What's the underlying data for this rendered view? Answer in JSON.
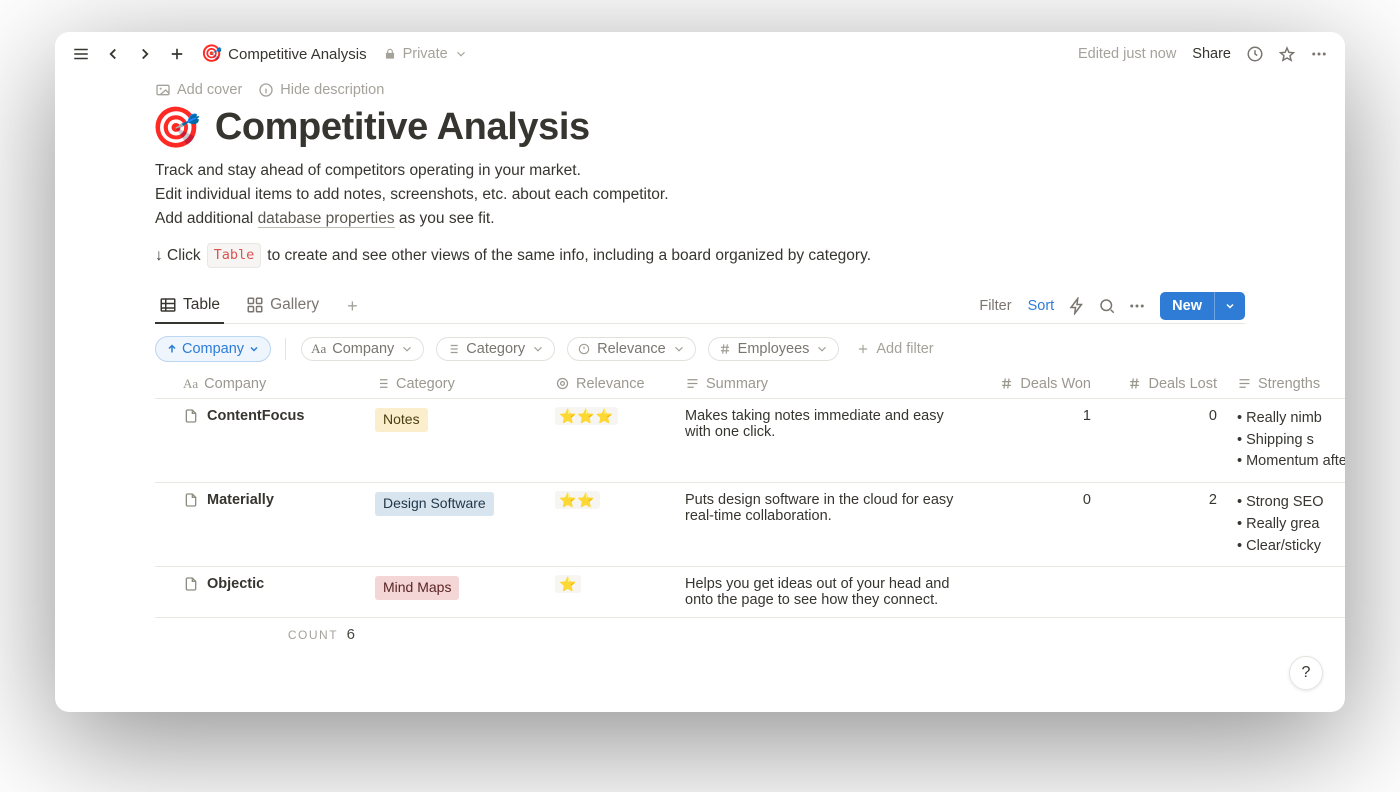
{
  "breadcrumb": {
    "emoji": "🎯",
    "title": "Competitive Analysis",
    "privacy": "Private"
  },
  "topbar": {
    "edited": "Edited just now",
    "share": "Share"
  },
  "cover": {
    "add_cover": "Add cover",
    "hide_desc": "Hide description"
  },
  "page": {
    "emoji": "🎯",
    "title": "Competitive Analysis",
    "desc_line1": "Track and stay ahead of competitors operating in your market.",
    "desc_line2": "Edit individual items to add notes, screenshots, etc. about each competitor.",
    "desc_line3_pre": "Add additional ",
    "desc_line3_link": "database properties",
    "desc_line3_post": " as you see fit.",
    "click_pre": "↓ Click ",
    "click_code": "Table",
    "click_post": " to create and see other views of the same info, including a board organized by category."
  },
  "views": {
    "tab_table": "Table",
    "tab_gallery": "Gallery",
    "filter": "Filter",
    "sort": "Sort",
    "new": "New"
  },
  "filters": {
    "sort_pill": "Company",
    "chip_company": "Company",
    "chip_category": "Category",
    "chip_relevance": "Relevance",
    "chip_employees": "Employees",
    "add_filter": "Add filter"
  },
  "columns": {
    "company": "Company",
    "category": "Category",
    "relevance": "Relevance",
    "summary": "Summary",
    "deals_won": "Deals Won",
    "deals_lost": "Deals Lost",
    "strengths": "Strengths"
  },
  "rows": [
    {
      "company": "ContentFocus",
      "category": "Notes",
      "category_class": "notes",
      "relevance": "⭐⭐⭐",
      "summary": "Makes taking notes immediate and easy with one click.",
      "won": "1",
      "lost": "0",
      "strengths": [
        "• Really nimb",
        "• Shipping s",
        "• Momentum after funding"
      ]
    },
    {
      "company": "Materially",
      "category": "Design Software",
      "category_class": "design",
      "relevance": "⭐⭐",
      "summary": "Puts design software in the cloud for easy real-time collaboration.",
      "won": "0",
      "lost": "2",
      "strengths": [
        "• Strong SEO",
        "• Really grea",
        "• Clear/sticky"
      ]
    },
    {
      "company": "Objectic",
      "category": "Mind Maps",
      "category_class": "mind",
      "relevance": "⭐",
      "summary": "Helps you get ideas out of your head and onto the page to see how they connect.",
      "won": "",
      "lost": "",
      "strengths": []
    }
  ],
  "footer": {
    "count_label": "count",
    "count_value": "6"
  },
  "help": "?"
}
